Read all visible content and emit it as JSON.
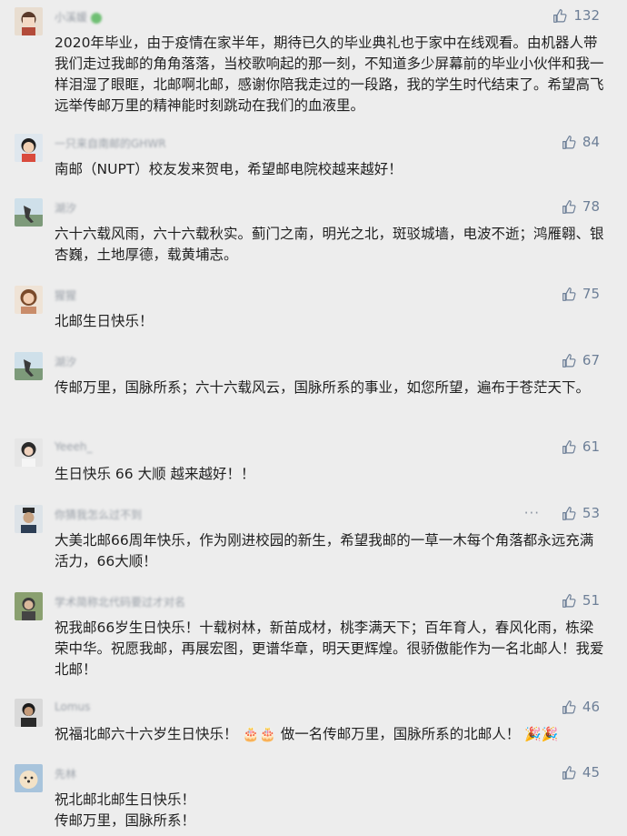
{
  "comments": [
    {
      "name": "小溪媛",
      "likes": "132",
      "text": "2020年毕业，由于疫情在家半年，期待已久的毕业典礼也于家中在线观看。由机器人带我们走过我邮的角角落落，当校歌响起的那一刻，不知道多少屏幕前的毕业小伙伴和我一样泪湿了眼眶，北邮啊北邮，感谢你陪我走过的一段路，我的学生时代结束了。希望高飞远举传邮万里的精神能时刻跳动在我们的血液里。"
    },
    {
      "name": "一只来自南邮的GHWR",
      "likes": "84",
      "text": "南邮（NUPT）校友发来贺电，希望邮电院校越来越好！"
    },
    {
      "name": "湖汐",
      "likes": "78",
      "text": "六十六载风雨，六十六载秋实。蓟门之南，明光之北，斑驳城墙，电波不逝；鸿雁翱、银杏巍，土地厚德，载黄埔志。"
    },
    {
      "name": "猩猩",
      "likes": "75",
      "text": "北邮生日快乐！"
    },
    {
      "name": "湖汐",
      "likes": "67",
      "text": "传邮万里，国脉所系；六十六载风云，国脉所系的事业，如您所望，遍布于苍茫天下。"
    },
    {
      "name": "Yeeeh_",
      "likes": "61",
      "text": "生日快乐 66 大顺 越来越好！！"
    },
    {
      "name": "你猜我怎么过不到",
      "likes": "53",
      "more": "···",
      "text": "大美北邮66周年快乐，作为刚进校园的新生，希望我邮的一草一木每个角落都永远充满活力，66大顺！"
    },
    {
      "name": "学术简称北代码要过才对名",
      "likes": "51",
      "text": "祝我邮66岁生日快乐！十载树林，新苗成材，桃李满天下；百年育人，春风化雨，栋梁荣中华。祝愿我邮，再展宏图，更谱华章，明天更辉煌。很骄傲能作为一名北邮人！我爱北邮！"
    },
    {
      "name": "Lomus",
      "likes": "46",
      "text_parts": [
        "祝福北邮六十六岁生日快乐！",
        "🎂🎂",
        "做一名传邮万里，国脉所系的北邮人！",
        "🎉🎉"
      ]
    },
    {
      "name": "先林",
      "likes": "45",
      "text_lines": [
        "祝北邮北邮生日快乐！",
        "传邮万里，国脉所系！"
      ]
    }
  ],
  "colors": {
    "background": "#ededed",
    "text": "#1f1f1f",
    "likes": "#6d7f97"
  },
  "icons": {
    "like": "thumbs-up-icon"
  }
}
